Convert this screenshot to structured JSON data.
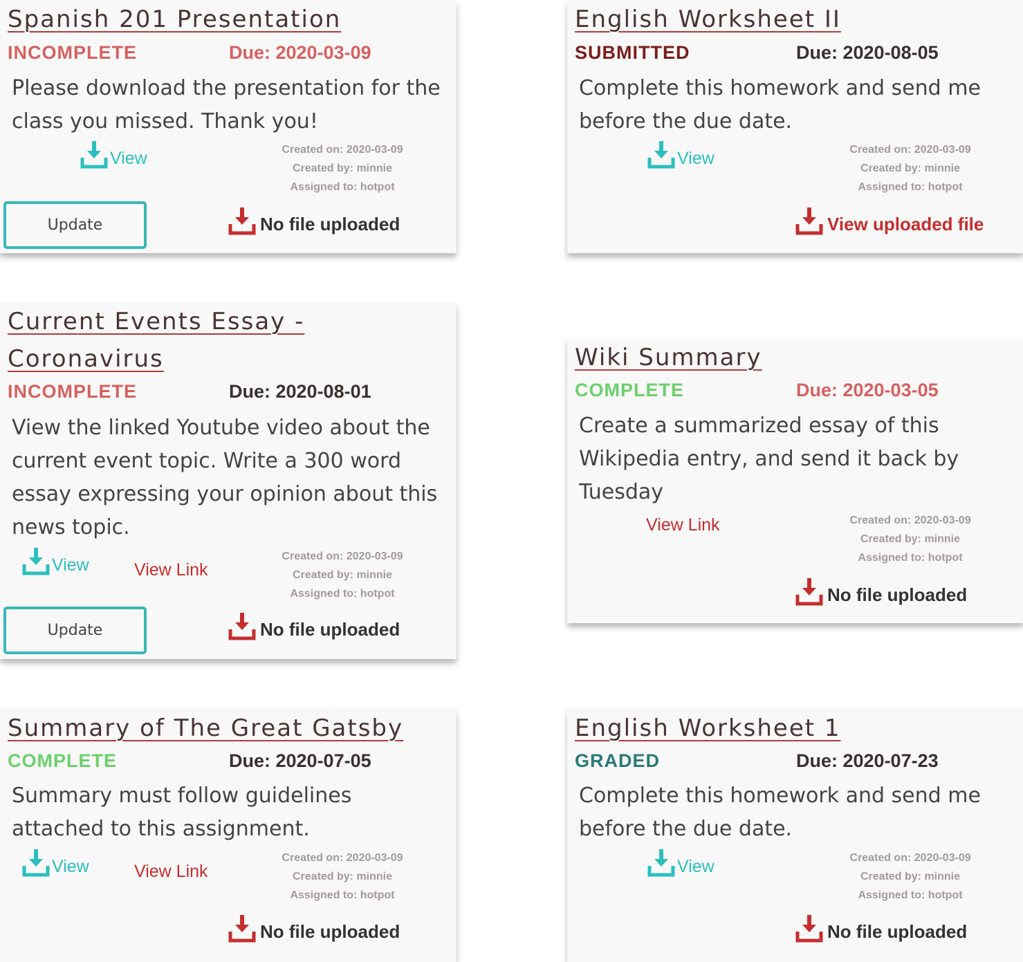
{
  "colors": {
    "incomplete": "#d86060",
    "submitted": "#7a1c1c",
    "complete": "#6cd06c",
    "graded": "#2a7a78",
    "due_overdue": "#d86060",
    "due_normal": "#3a3030",
    "teal": "#2bbfbf",
    "red": "#c62e2e"
  },
  "assignments": [
    {
      "title": "Spanish 201 Presentation",
      "status": "INCOMPLETE",
      "due": "Due: 2020-03-09",
      "description": "Please download the presentation for the class you missed. Thank you!",
      "view_label": "View",
      "created_on": "Created on: 2020-03-09",
      "created_by": "Created by: minnie",
      "assigned_to": "Assigned to: hotpot",
      "update_label": "Update",
      "file_label": "No file uploaded"
    },
    {
      "title": "English Worksheet II",
      "status": "SUBMITTED",
      "due": "Due: 2020-08-05",
      "description": "Complete this homework and send me before the due date.",
      "view_label": "View",
      "created_on": "Created on: 2020-03-09",
      "created_by": "Created by: minnie",
      "assigned_to": "Assigned to: hotpot",
      "file_label": "View uploaded file"
    },
    {
      "title": "Current Events Essay - Coronavirus",
      "status": "INCOMPLETE",
      "due": "Due: 2020-08-01",
      "description": "View the linked Youtube video about the current event topic. Write a 300 word essay expressing your opinion about this news topic.",
      "view_label": "View",
      "link_label": "View Link",
      "created_on": "Created on: 2020-03-09",
      "created_by": "Created by: minnie",
      "assigned_to": "Assigned to: hotpot",
      "update_label": "Update",
      "file_label": "No file uploaded"
    },
    {
      "title": "Wiki Summary",
      "status": "COMPLETE",
      "due": "Due: 2020-03-05",
      "description": "Create a summarized essay of this Wikipedia entry, and send it back by Tuesday",
      "link_label": "View Link",
      "created_on": "Created on: 2020-03-09",
      "created_by": "Created by: minnie",
      "assigned_to": "Assigned to: hotpot",
      "file_label": "No file uploaded"
    },
    {
      "title": "Summary of The Great Gatsby",
      "status": "COMPLETE",
      "due": "Due: 2020-07-05",
      "description": "Summary must follow guidelines attached to this assignment.",
      "view_label": "View",
      "link_label": "View Link",
      "created_on": "Created on: 2020-03-09",
      "created_by": "Created by: minnie",
      "assigned_to": "Assigned to: hotpot",
      "file_label": "No file uploaded"
    },
    {
      "title": "English Worksheet 1",
      "status": "GRADED",
      "due": "Due: 2020-07-23",
      "description": "Complete this homework and send me before the due date.",
      "view_label": "View",
      "created_on": "Created on: 2020-03-09",
      "created_by": "Created by: minnie",
      "assigned_to": "Assigned to: hotpot",
      "file_label": "No file uploaded"
    }
  ]
}
